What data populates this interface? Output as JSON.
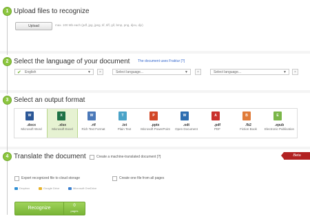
{
  "steps": [
    {
      "number": "1",
      "title": "Upload files to recognize"
    },
    {
      "number": "2",
      "title": "Select the language of your document"
    },
    {
      "number": "3",
      "title": "Select an output format"
    },
    {
      "number": "4",
      "title": "Translate the document"
    }
  ],
  "upload": {
    "button_label": "Upload",
    "hint": "max. 100 Mb each (pdf, jpg, jpeg, tif, tiff, gif, bmp, png, djvu, djv)"
  },
  "language": {
    "fraktur_link": "The document uses Fraktur [?]",
    "select1": "English",
    "select2_placeholder": "Select language...",
    "select3_placeholder": "Select language...",
    "clear_label": "×",
    "arrow": "▼"
  },
  "formats": [
    {
      "ext": ".docx",
      "name": "Microsoft Word",
      "icon": "W",
      "color": "#2b5797",
      "selected": false
    },
    {
      "ext": ".xlsx",
      "name": "Microsoft Excel",
      "icon": "X",
      "color": "#1e7145",
      "selected": true
    },
    {
      "ext": ".rtf",
      "name": "Rich Text Format",
      "icon": "W",
      "color": "#4a78b8",
      "selected": false
    },
    {
      "ext": ".txt",
      "name": "Plain Text",
      "icon": "T",
      "color": "#4aa3c8",
      "selected": false
    },
    {
      "ext": ".pptx",
      "name": "Microsoft PowerPoint",
      "icon": "P",
      "color": "#d24726",
      "selected": false
    },
    {
      "ext": ".odt",
      "name": "Open Document",
      "icon": "W",
      "color": "#2b6cb0",
      "selected": false
    },
    {
      "ext": ".pdf",
      "name": "PDF",
      "icon": "A",
      "color": "#c9302c",
      "selected": false
    },
    {
      "ext": ".fb2",
      "name": "Fiction Book",
      "icon": "B",
      "color": "#e07b39",
      "selected": false
    },
    {
      "ext": ".epub",
      "name": "Electronic Publication",
      "icon": "E",
      "color": "#7ab648",
      "selected": false
    }
  ],
  "translate": {
    "checkbox_label": "Create a machine-translated document [?]",
    "beta": "Beta"
  },
  "export": {
    "cloud_label": "Export recognized file to cloud storage",
    "one_file_label": "Create one file from all pages",
    "services": [
      "Dropbox",
      "Google Drive",
      "Microsoft OneDrive"
    ]
  },
  "recognize": {
    "label": "Recognize",
    "pages_count": "0",
    "pages_label": "pages"
  },
  "colors": {
    "accent": "#8cc63f",
    "link": "#3366cc",
    "beta": "#b22222"
  }
}
